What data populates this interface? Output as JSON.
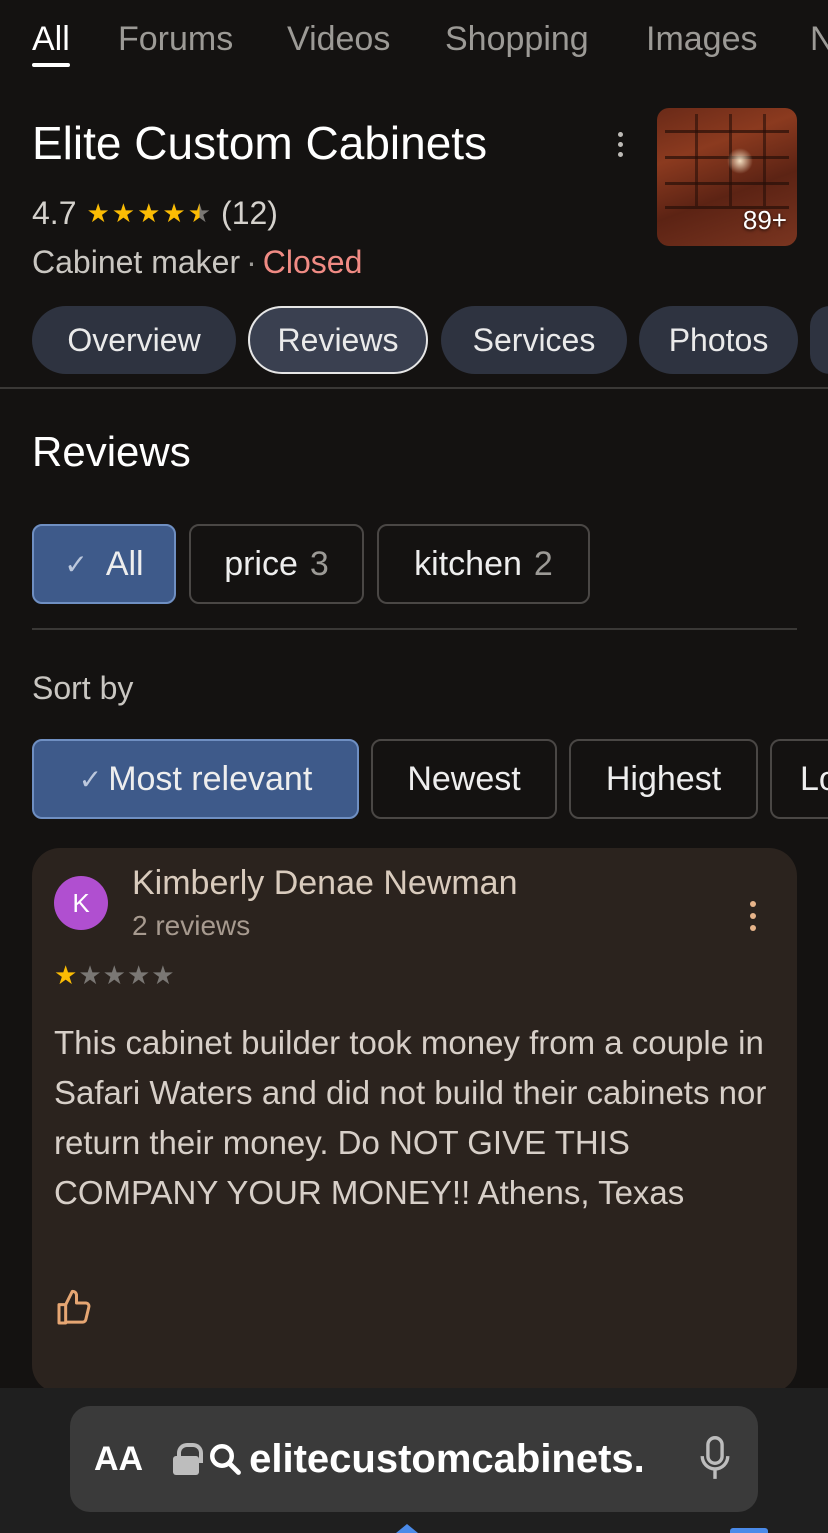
{
  "top_tabs": [
    "All",
    "Forums",
    "Videos",
    "Shopping",
    "Images",
    "N"
  ],
  "business": {
    "name": "Elite Custom Cabinets",
    "rating": "4.7",
    "review_count": "(12)",
    "category": "Cabinet maker",
    "separator": "·",
    "status": "Closed",
    "photo_count": "89+"
  },
  "section_chips": [
    "Overview",
    "Reviews",
    "Services",
    "Photos"
  ],
  "reviews": {
    "heading": "Reviews",
    "filters": [
      {
        "label": "All",
        "count": "",
        "selected": true
      },
      {
        "label": "price",
        "count": "3",
        "selected": false
      },
      {
        "label": "kitchen",
        "count": "2",
        "selected": false
      }
    ],
    "sort_label": "Sort by",
    "sort_options": [
      {
        "label": "Most relevant",
        "selected": true
      },
      {
        "label": "Newest",
        "selected": false
      },
      {
        "label": "Highest",
        "selected": false
      },
      {
        "label": "Lo",
        "selected": false
      }
    ],
    "items": [
      {
        "avatar_letter": "K",
        "author": "Kimberly Denae Newman",
        "author_reviews": "2 reviews",
        "stars": 1,
        "text": "This cabinet builder took money from a couple in Safari Waters and did not build their cabinets nor return their money. Do NOT GIVE THIS COMPANY YOUR MONEY!! Athens, Texas"
      }
    ]
  },
  "browser": {
    "aa_label": "AA",
    "url": "elitecustomcabinets."
  },
  "colors": {
    "closed": "#f08b84",
    "star": "#fbbc04",
    "selected_chip": "#3e5a8a",
    "avatar": "#b04fd0",
    "card_bg": "#2b231e"
  },
  "icons": [
    "more-vert-icon",
    "star-icon",
    "check-icon",
    "thumb-up-icon",
    "lock-icon",
    "search-icon",
    "mic-icon"
  ]
}
